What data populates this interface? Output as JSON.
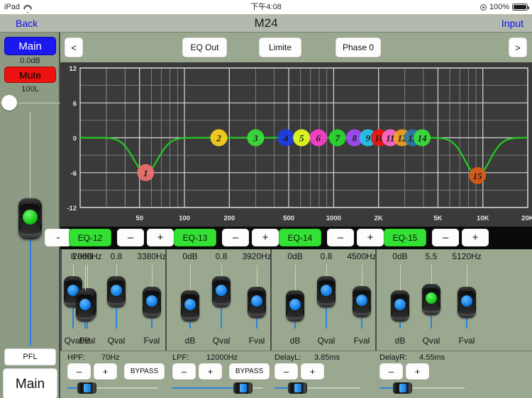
{
  "status_bar": {
    "device": "iPad",
    "wifi_icon": "wifi-icon",
    "time": "下午4:08",
    "location_icon": "location-icon",
    "battery_percent": "100%",
    "battery_icon": "battery-full-icon"
  },
  "nav": {
    "back_label": "Back",
    "title": "M24",
    "right_label": "Input"
  },
  "channel_strip": {
    "main_button": "Main",
    "gain_value": "0.0dB",
    "mute_button": "Mute",
    "pan_value": "100L",
    "pfl_button": "PFL",
    "name_button": "Main"
  },
  "toolbar": {
    "prev_label": "<",
    "next_label": ">",
    "eq_out_label": "EQ Out",
    "limiter_label": "Limite",
    "phase_label": "Phase 0"
  },
  "chart_data": {
    "type": "line",
    "title": "",
    "xlabel": "",
    "ylabel": "",
    "xscale": "log",
    "xlim": [
      20,
      20000
    ],
    "ylim": [
      -12,
      12
    ],
    "grid": true,
    "yticks": [
      12,
      6,
      0,
      -6,
      -12
    ],
    "ytick_labels": [
      "12",
      "6",
      "0",
      "-6",
      "-12"
    ],
    "xticks": [
      50,
      100,
      200,
      500,
      1000,
      2000,
      5000,
      10000,
      20000
    ],
    "xtick_labels": [
      "50",
      "100",
      "200",
      "500",
      "1000",
      "2K",
      "5K",
      "10K",
      "20K"
    ],
    "curve_color": "#22cc22",
    "bands": [
      {
        "id": 1,
        "freq": 55,
        "gain": -6.0,
        "q": 5.5,
        "color": "#f07070"
      },
      {
        "id": 2,
        "freq": 170,
        "gain": 0,
        "q": 0.8,
        "color": "#ffd21e"
      },
      {
        "id": 3,
        "freq": 300,
        "gain": 0,
        "q": 0.8,
        "color": "#3ae03a"
      },
      {
        "id": 4,
        "freq": 480,
        "gain": 0,
        "q": 0.8,
        "color": "#1c3ce8"
      },
      {
        "id": 5,
        "freq": 610,
        "gain": 0,
        "q": 0.8,
        "color": "#e6ff1e"
      },
      {
        "id": 6,
        "freq": 790,
        "gain": 0,
        "q": 0.8,
        "color": "#ff3ecb"
      },
      {
        "id": 7,
        "freq": 1060,
        "gain": 0,
        "q": 0.8,
        "color": "#28d82f"
      },
      {
        "id": 8,
        "freq": 1380,
        "gain": 0,
        "q": 0.8,
        "color": "#a14bf5"
      },
      {
        "id": 9,
        "freq": 1700,
        "gain": 0,
        "q": 0.8,
        "color": "#25c8f0"
      },
      {
        "id": 10,
        "freq": 2020,
        "gain": 0,
        "q": 0.8,
        "color": "#ee1414"
      },
      {
        "id": 11,
        "freq": 2400,
        "gain": 0,
        "q": 0.8,
        "color": "#ff69c8"
      },
      {
        "id": 12,
        "freq": 2880,
        "gain": 0,
        "q": 0.8,
        "color": "#f0a020"
      },
      {
        "id": 13,
        "freq": 3380,
        "gain": 0,
        "q": 0.8,
        "color": "#2878a8"
      },
      {
        "id": 14,
        "freq": 3920,
        "gain": 0,
        "q": 0.8,
        "color": "#3ae03a"
      },
      {
        "id": 15,
        "freq": 9200,
        "gain": -6.5,
        "q": 5.5,
        "color": "#dd5a18"
      }
    ],
    "annotations": [
      "EQ band handles numbered 1 through 15 on the response curve"
    ]
  },
  "band_controls": {
    "partial_left": {
      "qval": "8",
      "fval": "2880Hz"
    },
    "bands": [
      {
        "eq_label": "EQ-12",
        "minus": "–",
        "plus": "+",
        "db": "0dB",
        "qval": "0.8",
        "fval": "3380Hz",
        "db_pos": 0.54,
        "q_pos": 0.8,
        "f_pos": 0.6,
        "q_color": "blue"
      },
      {
        "eq_label": "EQ-13",
        "minus": "–",
        "plus": "+",
        "db": "0dB",
        "qval": "0.8",
        "fval": "3920Hz",
        "db_pos": 0.54,
        "q_pos": 0.8,
        "f_pos": 0.6,
        "q_color": "blue"
      },
      {
        "eq_label": "EQ-14",
        "minus": "–",
        "plus": "+",
        "db": "0dB",
        "qval": "0.8",
        "fval": "4500Hz",
        "db_pos": 0.54,
        "q_pos": 0.8,
        "f_pos": 0.62,
        "q_color": "blue"
      },
      {
        "eq_label": "EQ-15",
        "minus": "–",
        "plus": "+",
        "db": "0dB",
        "qval": "5.5",
        "fval": "5120Hz",
        "db_pos": 0.54,
        "q_pos": 0.66,
        "f_pos": 0.6,
        "q_color": "green"
      }
    ],
    "slot_labels": {
      "db": "dB",
      "q": "Qval",
      "f": "Fval"
    }
  },
  "bottom_panel": {
    "controls": [
      {
        "name": "HPF",
        "label": "HPF:",
        "value": "70Hz",
        "minus": "–",
        "plus": "+",
        "bypass": "BYPASS",
        "slider_pos": 0.14,
        "fill_from_left": true
      },
      {
        "name": "LPF",
        "label": "LPF:",
        "value": "12000Hz",
        "minus": "–",
        "plus": "+",
        "bypass": "BYPASS",
        "slider_pos": 0.85,
        "fill_from_left": true
      },
      {
        "name": "DelayL",
        "label": "DelayL:",
        "value": "3.85ms",
        "minus": "–",
        "plus": "+",
        "bypass": "",
        "slider_pos": 0.2,
        "fill_from_left": true
      },
      {
        "name": "DelayR",
        "label": "DelayR:",
        "value": "4.55ms",
        "minus": "–",
        "plus": "+",
        "bypass": "",
        "slider_pos": 0.2,
        "fill_from_left": true
      }
    ]
  },
  "colors": {
    "panel_bg": "#9aa88f",
    "strip_bg": "#8d9a84",
    "graph_bg": "#3a3a3a",
    "accent_blue": "#1111ee",
    "fader_blue": "#2a82df",
    "eq_green": "#33e033",
    "mute_red": "#ee1111",
    "main_blue": "#1a1af0"
  }
}
